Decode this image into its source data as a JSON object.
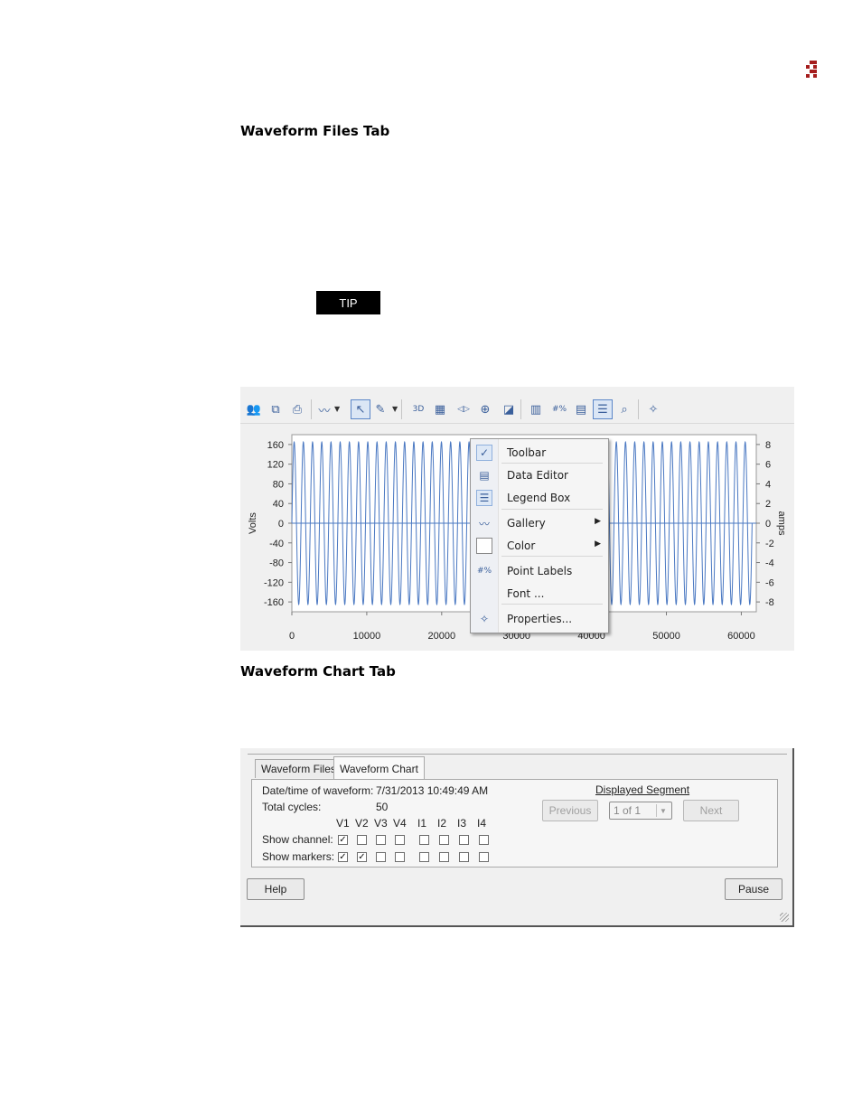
{
  "colors": {
    "logo": "#a51c1c",
    "wave": "#4a78c2",
    "tip_bg": "#000000"
  },
  "headings": {
    "files_tab": "Waveform Files Tab",
    "chart_tab": "Waveform Chart Tab"
  },
  "tip": {
    "label": "TIP"
  },
  "toolbar": {
    "icons": [
      "copy-users-icon",
      "copy-icon",
      "print-icon",
      "gallery-icon",
      "pointer-icon",
      "pencil-icon",
      "3d-icon",
      "rotate-icon",
      "zoom-icon",
      "axis-icon",
      "color-icon",
      "data-icon",
      "point-labels-icon",
      "data-editor-icon",
      "legend-icon",
      "magnify-icon",
      "properties-icon"
    ]
  },
  "context_menu": {
    "items": [
      {
        "label": "Toolbar",
        "icon": "check-icon"
      },
      {
        "label": "Data Editor",
        "icon": "data-editor-icon"
      },
      {
        "label": "Legend Box",
        "icon": "legend-box-icon"
      },
      {
        "label": "Gallery",
        "icon": "gallery-icon",
        "submenu": true
      },
      {
        "label": "Color",
        "icon": "color-icon",
        "submenu": true
      },
      {
        "label": "Point Labels",
        "icon": "point-labels-icon"
      },
      {
        "label": "Font ...",
        "icon": ""
      },
      {
        "label": "Properties...",
        "icon": "properties-icon"
      }
    ]
  },
  "chart_data": {
    "type": "line",
    "ylabel": "Volts",
    "y2label": "amps",
    "xlim": [
      0,
      62000
    ],
    "ylim": [
      -180,
      180
    ],
    "y2lim": [
      -9,
      9
    ],
    "x_ticks": [
      "0",
      "10000",
      "20000",
      "30000",
      "40000",
      "50000",
      "60000"
    ],
    "x_tick_values": [
      0,
      10000,
      20000,
      30000,
      40000,
      50000,
      60000
    ],
    "y_ticks": [
      "160",
      "120",
      "80",
      "40",
      "0",
      "-40",
      "-80",
      "-120",
      "-160"
    ],
    "y_tick_values": [
      160,
      120,
      80,
      40,
      0,
      -40,
      -80,
      -120,
      -160
    ],
    "y2_ticks": [
      "8",
      "6",
      "4",
      "2",
      "0",
      "-2",
      "-4",
      "-6",
      "-8"
    ],
    "y2_tick_values": [
      8,
      6,
      4,
      2,
      0,
      -2,
      -4,
      -6,
      -8
    ],
    "series": [
      {
        "amplitude": 165,
        "cycles": 50,
        "x_start": 0,
        "x_end": 61440
      }
    ],
    "grid": false
  },
  "waveform_chart": {
    "tabs": [
      "Waveform Files",
      "Waveform Chart"
    ],
    "active_tab": 1,
    "date_label": "Date/time of waveform:",
    "date_value": "7/31/2013 10:49:49 AM",
    "cycles_label": "Total cycles:",
    "cycles_value": "50",
    "channels": [
      "V1",
      "V2",
      "V3",
      "V4",
      "I1",
      "I2",
      "I3",
      "I4"
    ],
    "show_channel_label": "Show channel:",
    "show_channel": [
      true,
      false,
      false,
      false,
      false,
      false,
      false,
      false
    ],
    "show_markers_label": "Show markers:",
    "show_markers": [
      true,
      true,
      false,
      false,
      false,
      false,
      false,
      false
    ],
    "segment_label": "Displayed Segment",
    "previous_label": "Previous",
    "segment_value": "1 of 1",
    "next_label": "Next",
    "help_label": "Help",
    "pause_label": "Pause"
  }
}
